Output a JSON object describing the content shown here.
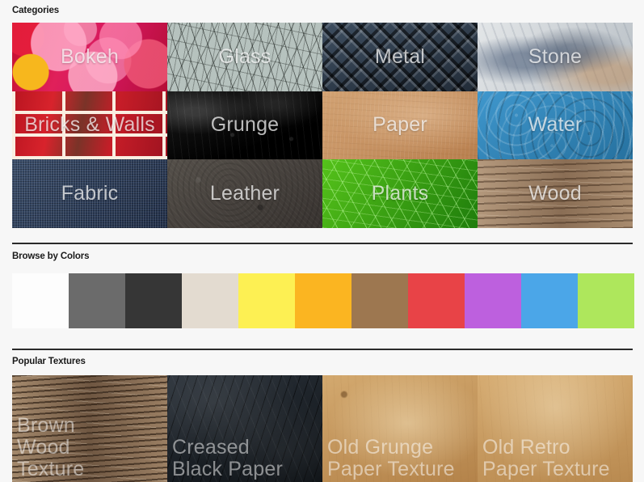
{
  "sections": {
    "categories": {
      "title": "Categories"
    },
    "colors": {
      "title": "Browse by Colors"
    },
    "popular": {
      "title": "Popular Textures"
    }
  },
  "categories": [
    {
      "label": "Bokeh",
      "texture": "bokeh"
    },
    {
      "label": "Glass",
      "texture": "glass"
    },
    {
      "label": "Metal",
      "texture": "metal"
    },
    {
      "label": "Stone",
      "texture": "stone"
    },
    {
      "label": "Bricks & Walls",
      "texture": "bricks"
    },
    {
      "label": "Grunge",
      "texture": "grunge"
    },
    {
      "label": "Paper",
      "texture": "paper"
    },
    {
      "label": "Water",
      "texture": "water"
    },
    {
      "label": "Fabric",
      "texture": "fabric"
    },
    {
      "label": "Leather",
      "texture": "leather"
    },
    {
      "label": "Plants",
      "texture": "plants"
    },
    {
      "label": "Wood",
      "texture": "wood"
    }
  ],
  "color_swatches": [
    {
      "name": "white",
      "hex": "#fdfdfd"
    },
    {
      "name": "gray",
      "hex": "#6b6b6b"
    },
    {
      "name": "black",
      "hex": "#363636"
    },
    {
      "name": "beige",
      "hex": "#e3dbd0"
    },
    {
      "name": "yellow",
      "hex": "#fdf053"
    },
    {
      "name": "orange",
      "hex": "#fbb521"
    },
    {
      "name": "brown",
      "hex": "#9d7750"
    },
    {
      "name": "red",
      "hex": "#e84347"
    },
    {
      "name": "purple",
      "hex": "#bd60de"
    },
    {
      "name": "blue",
      "hex": "#4ba6e8"
    },
    {
      "name": "green",
      "hex": "#aee75c"
    }
  ],
  "popular_textures": [
    {
      "label": "Brown\nWood\nTexture",
      "texture": "p-wood"
    },
    {
      "label": "Creased\nBlack Paper",
      "texture": "p-black"
    },
    {
      "label": "Old Grunge\nPaper Texture",
      "texture": "p-grunge"
    },
    {
      "label": "Old Retro\nPaper Texture",
      "texture": "p-retro"
    }
  ],
  "theme": {
    "background": "#f7f7f7",
    "divider": "#2b2b2b",
    "heading_color": "#1a1a1a",
    "tile_label_color": "rgba(255,255,255,0.72)"
  }
}
